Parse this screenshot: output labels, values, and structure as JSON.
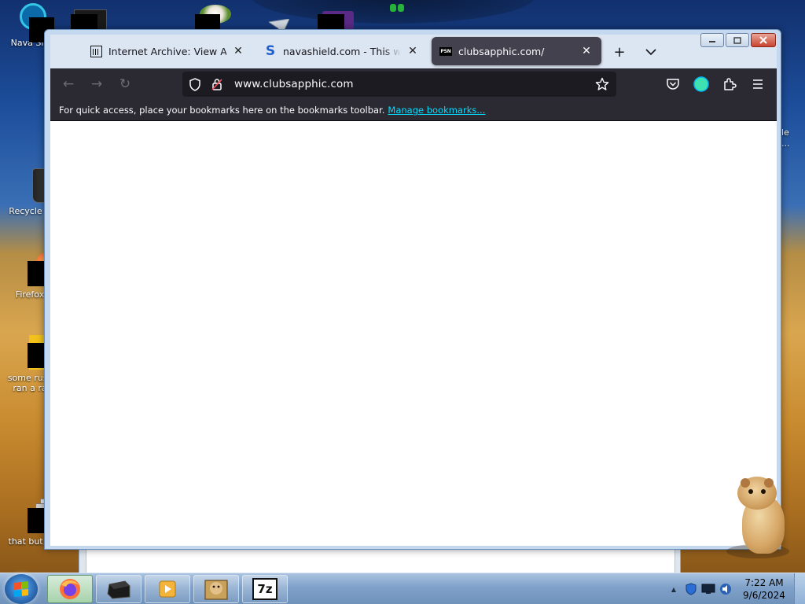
{
  "desktop": {
    "icons": [
      {
        "label": "Nava Shi"
      },
      {
        "label": "Recycle B"
      },
      {
        "label": "Firefox"
      },
      {
        "label_line1": "some russ",
        "label_line2": "ran a ra"
      },
      {
        "label": "that but it"
      }
    ],
    "right_clip": {
      "line1": "le",
      "line2": "..."
    }
  },
  "browser": {
    "tabs": [
      {
        "title": "Internet Archive: View Archive",
        "favicon": "archive-icon"
      },
      {
        "title": "navashield.com - This website",
        "favicon": "s-logo-icon"
      },
      {
        "title": "clubsapphic.com/",
        "favicon_text": "PSN",
        "active": true
      }
    ],
    "new_tab_symbol": "+",
    "list_tabs_symbol": "⌄",
    "window_controls": {
      "minimize": "▁",
      "maximize": "☐",
      "close": "✕"
    },
    "nav": {
      "back": "←",
      "forward": "→",
      "reload": "↻"
    },
    "url": "www.clubsapphic.com",
    "bookmarks_bar": {
      "message": "For quick access, place your bookmarks here on the bookmarks toolbar.",
      "link": "Manage bookmarks..."
    }
  },
  "taskbar": {
    "apps": [
      "firefox-icon",
      "terminal-icon",
      "media-player-icon",
      "hamster-box-icon",
      "7zip-icon"
    ],
    "active_app": "firefox-icon",
    "sevenzip_label": "7z",
    "tray": {
      "chevron": "▲",
      "time": "7:22 AM",
      "date": "9/6/2024"
    }
  },
  "colors": {
    "toolbar_bg": "#2b2a33",
    "urlbar_bg": "#1c1b22",
    "link": "#00ddff",
    "active_tab": "#42414d"
  }
}
